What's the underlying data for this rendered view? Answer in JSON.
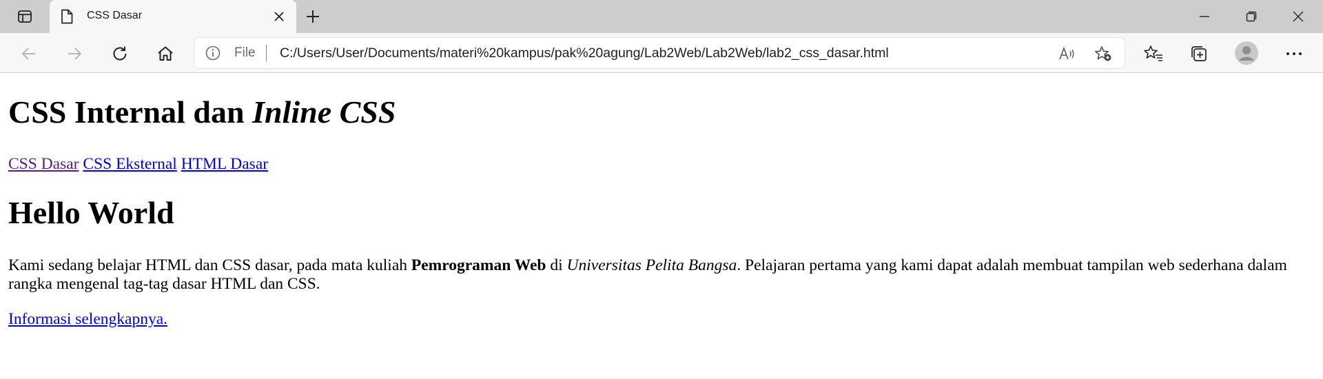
{
  "browser": {
    "tab_title": "CSS Dasar",
    "address": {
      "scheme_label": "File",
      "url": "C:/Users/User/Documents/materi%20kampus/pak%20agung/Lab2Web/Lab2Web/lab2_css_dasar.html"
    }
  },
  "page": {
    "title_normal": "CSS Internal dan ",
    "title_italic": "Inline CSS",
    "nav_links": [
      {
        "label": "CSS Dasar",
        "visited": true
      },
      {
        "label": "CSS Eksternal",
        "visited": false
      },
      {
        "label": "HTML Dasar",
        "visited": false
      }
    ],
    "heading": "Hello World",
    "paragraph": {
      "part1": "Kami sedang belajar HTML dan CSS dasar, pada mata kuliah ",
      "bold": "Pemrograman Web",
      "part2": " di ",
      "italic": "Universitas Pelita Bangsa",
      "part3": ". Pelajaran pertama yang kami dapat adalah membuat tampilan web sederhana dalam rangka mengenal tag-tag dasar HTML dan CSS."
    },
    "more_link": "Informasi selengkapnya."
  },
  "colors": {
    "link": "#0000ee",
    "visited_link": "#551a8b",
    "tabstrip_bg": "#cdcdcd",
    "toolbar_bg": "#f7f7f7"
  },
  "icons": [
    "tab-actions-icon",
    "page-icon",
    "close-icon",
    "plus-icon",
    "minimize-icon",
    "restore-icon",
    "close-window-icon",
    "back-icon",
    "forward-icon",
    "refresh-icon",
    "home-icon",
    "info-icon",
    "read-aloud-icon",
    "add-favorite-icon",
    "favorites-icon",
    "collections-icon",
    "profile-icon",
    "more-icon"
  ]
}
